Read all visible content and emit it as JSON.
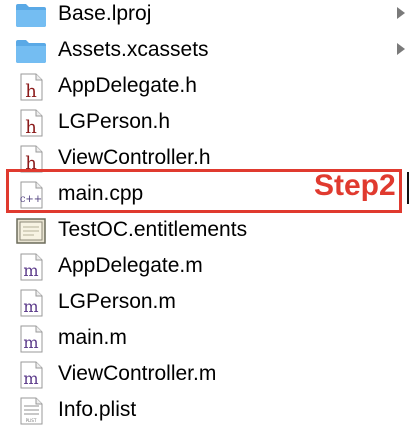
{
  "navigator": {
    "items": [
      {
        "label": "Base.lproj",
        "icon": "folder-icon",
        "kind": "folder",
        "disclosure": "chevron-right-icon"
      },
      {
        "label": "Assets.xcassets",
        "icon": "folder-icon",
        "kind": "folder",
        "disclosure": "chevron-right-icon"
      },
      {
        "label": "AppDelegate.h",
        "icon": "header-file-icon",
        "kind": "h",
        "glyph": "h"
      },
      {
        "label": "LGPerson.h",
        "icon": "header-file-icon",
        "kind": "h",
        "glyph": "h"
      },
      {
        "label": "ViewController.h",
        "icon": "header-file-icon",
        "kind": "h",
        "glyph": "h"
      },
      {
        "label": "main.cpp",
        "icon": "cpp-file-icon",
        "kind": "cpp",
        "glyph": "c++"
      },
      {
        "label": "TestOC.entitlements",
        "icon": "entitlements-file-icon",
        "kind": "entitlements"
      },
      {
        "label": "AppDelegate.m",
        "icon": "objc-file-icon",
        "kind": "m",
        "glyph": "m"
      },
      {
        "label": "LGPerson.m",
        "icon": "objc-file-icon",
        "kind": "m",
        "glyph": "m"
      },
      {
        "label": "main.m",
        "icon": "objc-file-icon",
        "kind": "m",
        "glyph": "m"
      },
      {
        "label": "ViewController.m",
        "icon": "objc-file-icon",
        "kind": "m",
        "glyph": "m"
      },
      {
        "label": "Info.plist",
        "icon": "plist-file-icon",
        "kind": "plist",
        "glyph": "PLIST"
      }
    ]
  },
  "annotation": {
    "step_label": "Step2",
    "color": "#e03a2f"
  },
  "colors": {
    "folder": "#5aa9e6",
    "header_glyph": "#8b1a1a",
    "objc_glyph": "#5b3a8a",
    "cpp_glyph": "#4a3a7a",
    "chevron": "#7a7a7a"
  }
}
